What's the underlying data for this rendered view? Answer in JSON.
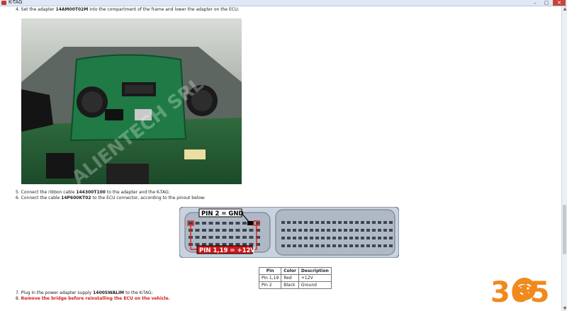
{
  "window": {
    "title": "K-TAG",
    "buttons": [
      "–",
      "▢",
      "✕"
    ]
  },
  "steps": {
    "s4": {
      "num": "4.",
      "pre": "Set the adapter ",
      "code": "14AM00T02M",
      "post": " into the compartment of the frame and lower the adapter on the ECU:"
    },
    "s5": {
      "num": "5.",
      "pre": "Connect the ribbon cable ",
      "code": "144300T100",
      "post": " to the adapter and the K-TAG;"
    },
    "s6": {
      "num": "6.",
      "pre": "Connect the cable ",
      "code": "14P600KT02",
      "post": " to the ECU connector, according to the pinout below:"
    },
    "s7": {
      "num": "7.",
      "pre": "Plug in the power adapter supply ",
      "code": "1400SWALIM",
      "post": " to the K-TAG;"
    },
    "s8": {
      "num": "8.",
      "text": "Remove the bridge before reinstalling the ECU on the vehicle."
    }
  },
  "photo": {
    "watermark": "ALIENTECH SRL"
  },
  "connector": {
    "gnd_label": "PIN 2 = GND",
    "v12_label": "PIN 1,19 = +12V"
  },
  "pin_table": {
    "headers": [
      "Pin",
      "Color",
      "Description"
    ],
    "rows": [
      [
        "Pin 1,19",
        "Red",
        "+12V"
      ],
      [
        "Pin 2",
        "Black",
        "Ground"
      ]
    ]
  },
  "logo": {
    "text": "365"
  },
  "colors": {
    "accent_red": "#d0201a",
    "logo_orange": "#f08a1c",
    "pcb_green": "#1f7a45"
  }
}
